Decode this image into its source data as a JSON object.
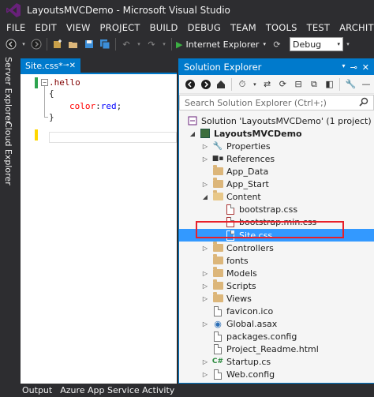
{
  "window": {
    "title": "LayoutsMVCDemo - Microsoft Visual Studio"
  },
  "menu": [
    "FILE",
    "EDIT",
    "VIEW",
    "PROJECT",
    "BUILD",
    "DEBUG",
    "TEAM",
    "TOOLS",
    "TEST",
    "ARCHITECTU"
  ],
  "toolbar": {
    "run_target": "Internet Explorer",
    "configuration": "Debug"
  },
  "left_tabs": [
    "Server Explorer",
    "Cloud Explorer"
  ],
  "editor": {
    "tab_label": "Site.css*",
    "code": {
      "line1": ".hello",
      "line2": "{",
      "line3_prop": "color",
      "line3_val": "red",
      "line4": "}"
    }
  },
  "solution_explorer": {
    "title": "Solution Explorer",
    "search_placeholder": "Search Solution Explorer (Ctrl+;)",
    "items": [
      {
        "label": "Solution 'LayoutsMVCDemo' (1 project)",
        "icon": "solution-icon"
      },
      {
        "label": "LayoutsMVCDemo",
        "icon": "web-project-icon"
      },
      {
        "label": "Properties",
        "icon": "wrench-icon"
      },
      {
        "label": "References",
        "icon": "references-icon"
      },
      {
        "label": "App_Data",
        "icon": "folder-icon"
      },
      {
        "label": "App_Start",
        "icon": "folder-icon"
      },
      {
        "label": "Content",
        "icon": "folder-open-icon"
      },
      {
        "label": "bootstrap.css",
        "icon": "css-file-icon"
      },
      {
        "label": "bootstrap.min.css",
        "icon": "css-file-icon"
      },
      {
        "label": "Site.css",
        "icon": "css-file-icon"
      },
      {
        "label": "Controllers",
        "icon": "folder-icon"
      },
      {
        "label": "fonts",
        "icon": "folder-icon"
      },
      {
        "label": "Models",
        "icon": "folder-icon"
      },
      {
        "label": "Scripts",
        "icon": "folder-icon"
      },
      {
        "label": "Views",
        "icon": "folder-icon"
      },
      {
        "label": "favicon.ico",
        "icon": "ico-file-icon"
      },
      {
        "label": "Global.asax",
        "icon": "global-asax-icon"
      },
      {
        "label": "packages.config",
        "icon": "config-file-icon"
      },
      {
        "label": "Project_Readme.html",
        "icon": "html-file-icon"
      },
      {
        "label": "Startup.cs",
        "icon": "csharp-file-icon"
      },
      {
        "label": "Web.config",
        "icon": "config-file-icon"
      }
    ]
  },
  "bottom_tabs": [
    "Output",
    "Azure App Service Activity"
  ],
  "colors": {
    "chrome": "#2d2d30",
    "accent": "#007acc",
    "selection": "#3399ff",
    "highlight_border": "#e8202a",
    "code_keyword": "#800000",
    "code_prop": "#ff0000",
    "code_value": "#0000ff"
  }
}
